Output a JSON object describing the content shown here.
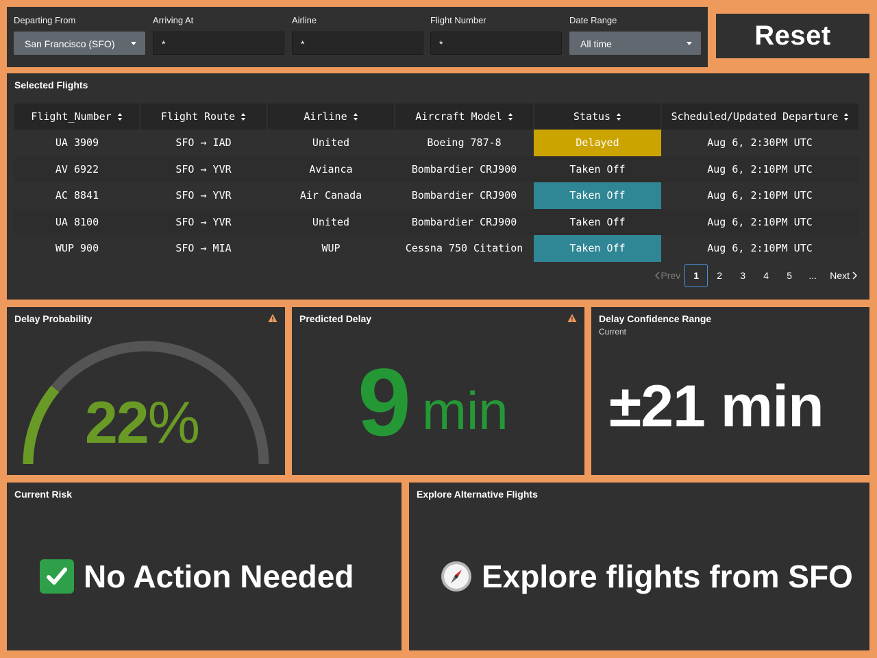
{
  "filters": {
    "departing_label": "Departing From",
    "departing_value": "San Francisco (SFO)",
    "arriving_label": "Arriving At",
    "arriving_value": "*",
    "airline_label": "Airline",
    "airline_value": "*",
    "flight_number_label": "Flight Number",
    "flight_number_value": "*",
    "date_range_label": "Date Range",
    "date_range_value": "All time"
  },
  "reset_label": "Reset",
  "flights": {
    "title": "Selected Flights",
    "columns": [
      "Flight_Number",
      "Flight Route",
      "Airline",
      "Aircraft Model",
      "Status",
      "Scheduled/Updated Departure"
    ],
    "rows": [
      [
        "UA 3909",
        "SFO → IAD",
        "United",
        "Boeing 787-8",
        "Delayed",
        "Aug 6, 2:30PM UTC"
      ],
      [
        "AV 6922",
        "SFO → YVR",
        "Avianca",
        "Bombardier CRJ900",
        "Taken Off",
        "Aug 6, 2:10PM UTC"
      ],
      [
        "AC 8841",
        "SFO → YVR",
        "Air Canada",
        "Bombardier CRJ900",
        "Taken Off",
        "Aug 6, 2:10PM UTC"
      ],
      [
        "UA 8100",
        "SFO → YVR",
        "United",
        "Bombardier CRJ900",
        "Taken Off",
        "Aug 6, 2:10PM UTC"
      ],
      [
        "WUP 900",
        "SFO → MIA",
        "WUP",
        "Cessna 750 Citation",
        "Taken Off",
        "Aug 6, 2:10PM UTC"
      ]
    ],
    "pager": {
      "prev": "Prev",
      "pages": [
        "1",
        "2",
        "3",
        "4",
        "5",
        "..."
      ],
      "next": "Next",
      "current": "1"
    }
  },
  "delay_probability": {
    "title": "Delay Probability",
    "value": 22,
    "display": "22",
    "unit": "%",
    "gauge_color": "#6a9a26",
    "track_color": "#555555"
  },
  "predicted_delay": {
    "title": "Predicted Delay",
    "value": "9",
    "unit": "min"
  },
  "confidence": {
    "title": "Delay Confidence Range",
    "subtitle": "Current",
    "value": "±21 min"
  },
  "risk": {
    "title": "Current Risk",
    "text": "No Action Needed",
    "icon": "check-icon"
  },
  "alternatives": {
    "title": "Explore Alternative Flights",
    "text": "Explore flights from SFO",
    "icon": "compass-icon"
  },
  "colors": {
    "background": "#ee9a5d",
    "panel": "#303030",
    "delayed": "#cca400",
    "taken_off": "#2f8795",
    "warning": "#ee9a5d",
    "green": "#259836"
  }
}
